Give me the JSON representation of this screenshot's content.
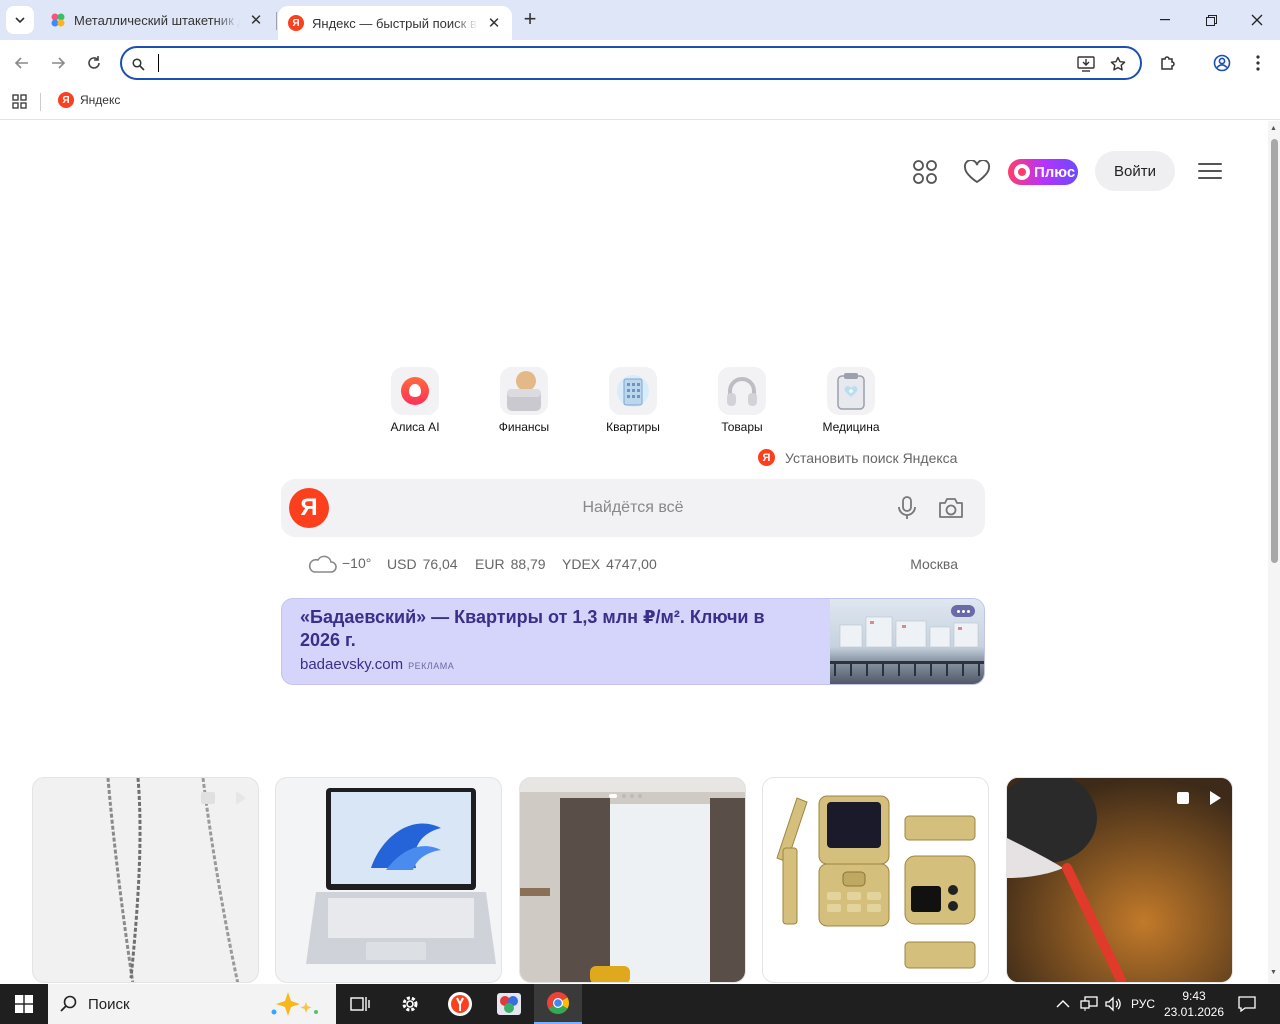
{
  "browser": {
    "tabs": [
      {
        "title": "Металлический штакетник для"
      },
      {
        "title": "Яндекс — быстрый поиск в ин"
      }
    ],
    "address": {
      "value": ""
    },
    "bookmarks": [
      {
        "label": "Яндекс"
      }
    ]
  },
  "header": {
    "plus_label": "Плюс",
    "login_label": "Войти"
  },
  "services": [
    {
      "label": "Алиса AI"
    },
    {
      "label": "Финансы"
    },
    {
      "label": "Квартиры"
    },
    {
      "label": "Товары"
    },
    {
      "label": "Медицина"
    }
  ],
  "install_label": "Установить поиск Яндекса",
  "search": {
    "logo": "Я",
    "placeholder": "Найдётся всё"
  },
  "info": {
    "temperature": "−10°",
    "usd_label": "USD",
    "usd_value": "76,04",
    "eur_label": "EUR",
    "eur_value": "88,79",
    "ydex_label": "YDEX",
    "ydex_value": "4747,00",
    "city": "Москва"
  },
  "ad": {
    "title": "«Бадаевский» — Квартиры от 1,3 млн ₽/м². Ключи в 2026 г.",
    "domain": "badaevsky.com",
    "label": "РЕКЛАМА"
  },
  "taskbar": {
    "search_label": "Поиск",
    "lang": "РУС",
    "time": "9:43",
    "date": "23.01.2026"
  },
  "colors": {
    "yandex_red": "#fc3f1d",
    "omnibox_border": "#1a4fb4",
    "ad_background": "#d5d5fc",
    "ad_text": "#3a2f8a"
  }
}
